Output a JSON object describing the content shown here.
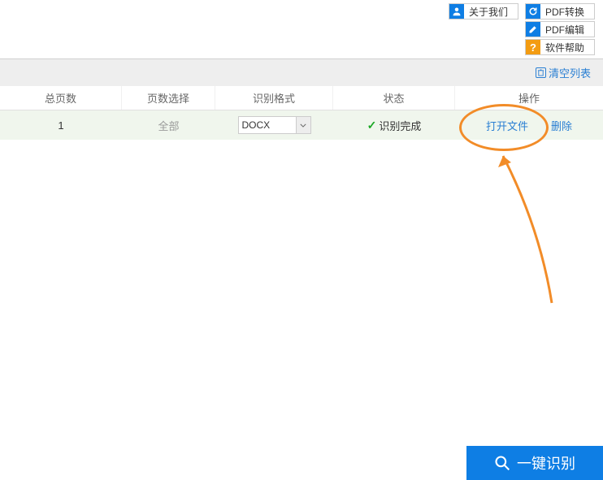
{
  "toolbar": {
    "about_label": "关于我们",
    "pdf_convert_label": "PDF转换",
    "pdf_edit_label": "PDF编辑",
    "software_help_label": "软件帮助"
  },
  "actions": {
    "clear_list_label": "清空列表"
  },
  "table": {
    "headers": {
      "total_pages": "总页数",
      "page_select": "页数选择",
      "format": "识别格式",
      "status": "状态",
      "action": "操作"
    },
    "rows": [
      {
        "total_pages": "1",
        "page_select": "全部",
        "format": "DOCX",
        "status": "识别完成",
        "open_file": "打开文件",
        "delete": "删除"
      }
    ]
  },
  "main_button": {
    "label": "一键识别"
  }
}
